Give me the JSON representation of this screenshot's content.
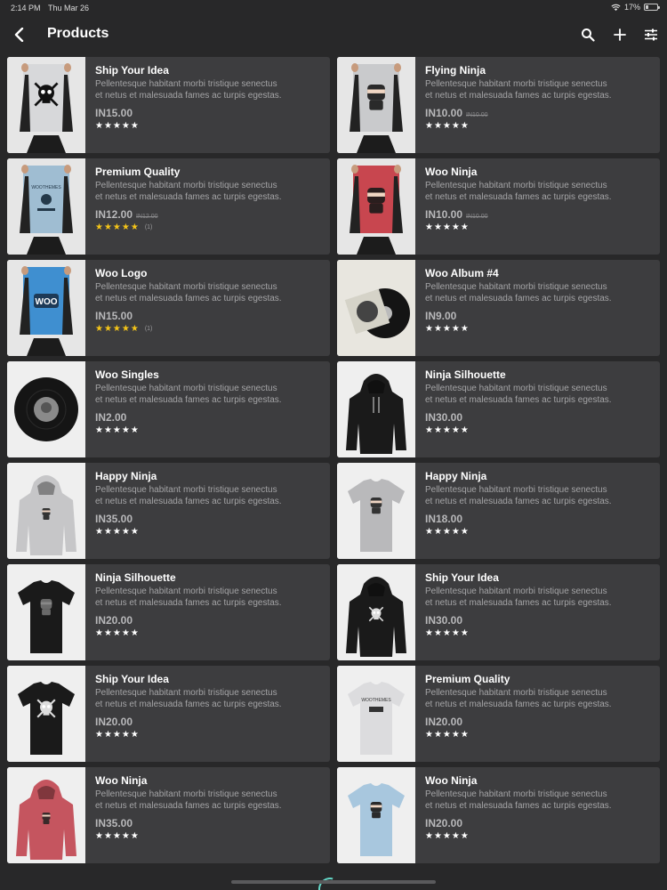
{
  "status": {
    "time": "2:14 PM",
    "date": "Thu Mar 26",
    "battery": "17%"
  },
  "app_bar": {
    "title": "Products"
  },
  "products": [
    {
      "name": "Ship Your Idea",
      "desc1": "Pellentesque habitant morbi tristique senectus",
      "desc2": "et netus et malesuada fames ac turpis egestas.",
      "price": "IN15.00",
      "regular": "",
      "stars": "★★★★★",
      "gold": false,
      "count": "",
      "art": "poster-skull"
    },
    {
      "name": "Flying Ninja",
      "desc1": "Pellentesque habitant morbi tristique senectus",
      "desc2": "et netus et malesuada fames ac turpis egestas.",
      "price": "IN10.00",
      "regular": "IN10.00",
      "stars": "★★★★★",
      "gold": false,
      "count": "",
      "art": "poster-ninja-grey"
    },
    {
      "name": "Premium Quality",
      "desc1": "Pellentesque habitant morbi tristique senectus",
      "desc2": "et netus et malesuada fames ac turpis egestas.",
      "price": "IN12.00",
      "regular": "IN12.00",
      "stars": "★★★★★",
      "gold": true,
      "count": "(1)",
      "art": "poster-premium"
    },
    {
      "name": "Woo Ninja",
      "desc1": "Pellentesque habitant morbi tristique senectus",
      "desc2": "et netus et malesuada fames ac turpis egestas.",
      "price": "IN10.00",
      "regular": "IN10.00",
      "stars": "★★★★★",
      "gold": false,
      "count": "",
      "art": "poster-ninja-red"
    },
    {
      "name": "Woo Logo",
      "desc1": "Pellentesque habitant morbi tristique senectus",
      "desc2": "et netus et malesuada fames ac turpis egestas.",
      "price": "IN15.00",
      "regular": "",
      "stars": "★★★★★",
      "gold": true,
      "count": "(1)",
      "art": "poster-woo"
    },
    {
      "name": "Woo Album #4",
      "desc1": "Pellentesque habitant morbi tristique senectus",
      "desc2": "et netus et malesuada fames ac turpis egestas.",
      "price": "IN9.00",
      "regular": "",
      "stars": "★★★★★",
      "gold": false,
      "count": "",
      "art": "album"
    },
    {
      "name": "Woo Singles",
      "desc1": "Pellentesque habitant morbi tristique senectus",
      "desc2": "et netus et malesuada fames ac turpis egestas.",
      "price": "IN2.00",
      "regular": "",
      "stars": "★★★★★",
      "gold": false,
      "count": "",
      "art": "vinyl"
    },
    {
      "name": "Ninja Silhouette",
      "desc1": "Pellentesque habitant morbi tristique senectus",
      "desc2": "et netus et malesuada fames ac turpis egestas.",
      "price": "IN30.00",
      "regular": "",
      "stars": "★★★★★",
      "gold": false,
      "count": "",
      "art": "hoodie-black"
    },
    {
      "name": "Happy Ninja",
      "desc1": "Pellentesque habitant morbi tristique senectus",
      "desc2": "et netus et malesuada fames ac turpis egestas.",
      "price": "IN35.00",
      "regular": "",
      "stars": "★★★★★",
      "gold": false,
      "count": "",
      "art": "hoodie-grey"
    },
    {
      "name": "Happy Ninja",
      "desc1": "Pellentesque habitant morbi tristique senectus",
      "desc2": "et netus et malesuada fames ac turpis egestas.",
      "price": "IN18.00",
      "regular": "",
      "stars": "★★★★★",
      "gold": false,
      "count": "",
      "art": "tee-grey"
    },
    {
      "name": "Ninja Silhouette",
      "desc1": "Pellentesque habitant morbi tristique senectus",
      "desc2": "et netus et malesuada fames ac turpis egestas.",
      "price": "IN20.00",
      "regular": "",
      "stars": "★★★★★",
      "gold": false,
      "count": "",
      "art": "tee-black-ninja"
    },
    {
      "name": "Ship Your Idea",
      "desc1": "Pellentesque habitant morbi tristique senectus",
      "desc2": "et netus et malesuada fames ac turpis egestas.",
      "price": "IN30.00",
      "regular": "",
      "stars": "★★★★★",
      "gold": false,
      "count": "",
      "art": "hoodie-black-skull"
    },
    {
      "name": "Ship Your Idea",
      "desc1": "Pellentesque habitant morbi tristique senectus",
      "desc2": "et netus et malesuada fames ac turpis egestas.",
      "price": "IN20.00",
      "regular": "",
      "stars": "★★★★★",
      "gold": false,
      "count": "",
      "art": "tee-black-skull"
    },
    {
      "name": "Premium Quality",
      "desc1": "Pellentesque habitant morbi tristique senectus",
      "desc2": "et netus et malesuada fames ac turpis egestas.",
      "price": "IN20.00",
      "regular": "",
      "stars": "★★★★★",
      "gold": false,
      "count": "",
      "art": "tee-white-premium"
    },
    {
      "name": "Woo Ninja",
      "desc1": "Pellentesque habitant morbi tristique senectus",
      "desc2": "et netus et malesuada fames ac turpis egestas.",
      "price": "IN35.00",
      "regular": "",
      "stars": "★★★★★",
      "gold": false,
      "count": "",
      "art": "hoodie-red"
    },
    {
      "name": "Woo Ninja",
      "desc1": "Pellentesque habitant morbi tristique senectus",
      "desc2": "et netus et malesuada fames ac turpis egestas.",
      "price": "IN20.00",
      "regular": "",
      "stars": "★★★★★",
      "gold": false,
      "count": "",
      "art": "tee-blue"
    }
  ],
  "colors": {
    "background": "#282829",
    "card": "#3d3d3f",
    "star_gold": "#f5c518",
    "accent": "#63d6c6"
  }
}
